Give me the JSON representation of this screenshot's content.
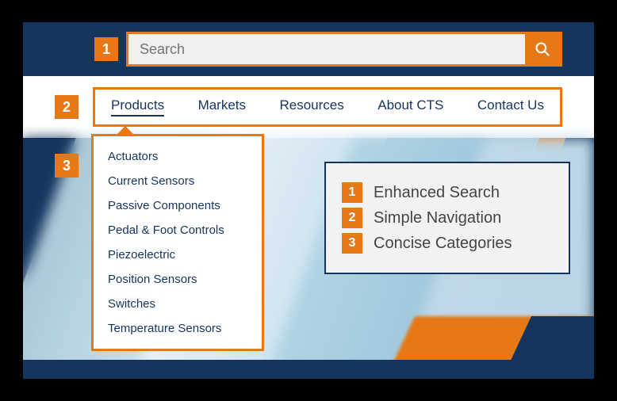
{
  "search": {
    "placeholder": "Search"
  },
  "nav": {
    "items": [
      {
        "label": "Products"
      },
      {
        "label": "Markets"
      },
      {
        "label": "Resources"
      },
      {
        "label": "About CTS"
      },
      {
        "label": "Contact Us"
      }
    ]
  },
  "dropdown": {
    "items": [
      {
        "label": "Actuators"
      },
      {
        "label": "Current Sensors"
      },
      {
        "label": "Passive Components"
      },
      {
        "label": "Pedal & Foot Controls"
      },
      {
        "label": "Piezoelectric"
      },
      {
        "label": "Position Sensors"
      },
      {
        "label": "Switches"
      },
      {
        "label": "Temperature Sensors"
      }
    ]
  },
  "badges": {
    "b1": "1",
    "b2": "2",
    "b3": "3"
  },
  "legend": {
    "items": [
      {
        "num": "1",
        "text": "Enhanced Search"
      },
      {
        "num": "2",
        "text": "Simple Navigation"
      },
      {
        "num": "3",
        "text": "Concise Categories"
      }
    ]
  }
}
